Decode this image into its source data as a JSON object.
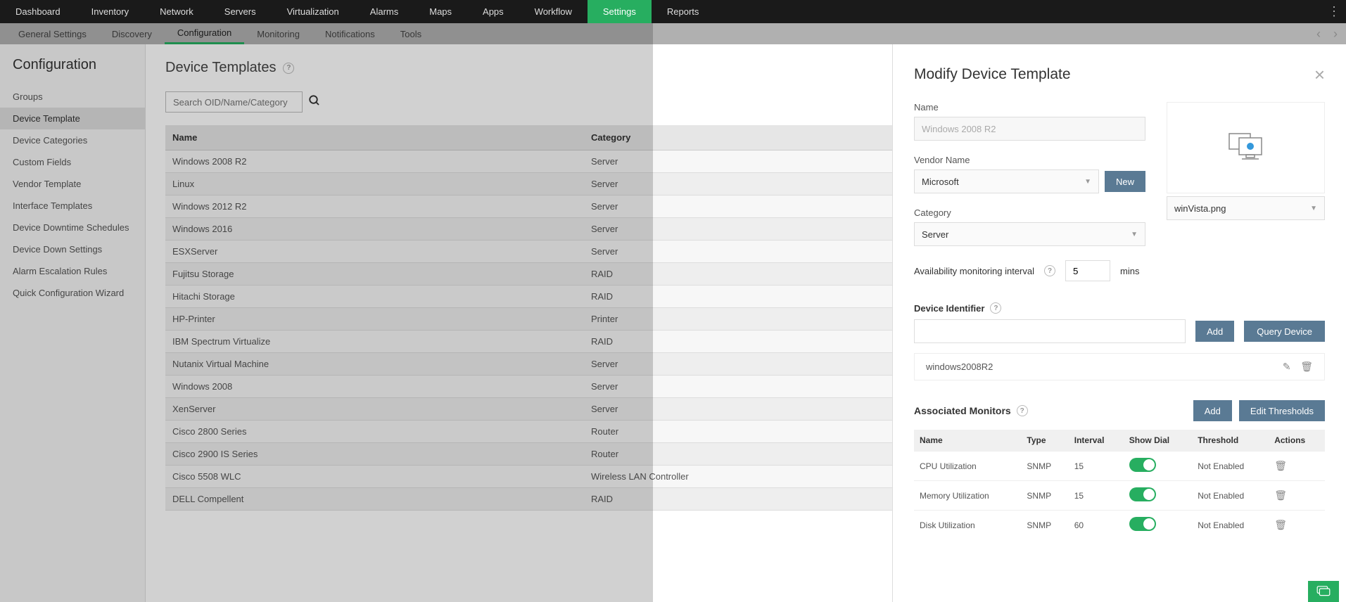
{
  "topnav": {
    "items": [
      "Dashboard",
      "Inventory",
      "Network",
      "Servers",
      "Virtualization",
      "Alarms",
      "Maps",
      "Apps",
      "Workflow",
      "Settings",
      "Reports"
    ],
    "active_index": 9
  },
  "subnav": {
    "items": [
      "General Settings",
      "Discovery",
      "Configuration",
      "Monitoring",
      "Notifications",
      "Tools"
    ],
    "active_index": 2
  },
  "sidebar": {
    "title": "Configuration",
    "items": [
      "Groups",
      "Device Template",
      "Device Categories",
      "Custom Fields",
      "Vendor Template",
      "Interface Templates",
      "Device Downtime Schedules",
      "Device Down Settings",
      "Alarm Escalation Rules",
      "Quick Configuration Wizard"
    ],
    "active_index": 1
  },
  "content": {
    "title": "Device Templates",
    "search_placeholder": "Search OID/Name/Category",
    "columns": [
      "Name",
      "Category"
    ],
    "rows": [
      {
        "name": "Windows 2008 R2",
        "category": "Server"
      },
      {
        "name": "Linux",
        "category": "Server"
      },
      {
        "name": "Windows 2012 R2",
        "category": "Server"
      },
      {
        "name": "Windows 2016",
        "category": "Server"
      },
      {
        "name": "ESXServer",
        "category": "Server"
      },
      {
        "name": "Fujitsu Storage",
        "category": "RAID"
      },
      {
        "name": "Hitachi Storage",
        "category": "RAID"
      },
      {
        "name": "HP-Printer",
        "category": "Printer"
      },
      {
        "name": "IBM Spectrum Virtualize",
        "category": "RAID"
      },
      {
        "name": "Nutanix Virtual Machine",
        "category": "Server"
      },
      {
        "name": "Windows 2008",
        "category": "Server"
      },
      {
        "name": "XenServer",
        "category": "Server"
      },
      {
        "name": "Cisco 2800 Series",
        "category": "Router"
      },
      {
        "name": "Cisco 2900 IS Series",
        "category": "Router"
      },
      {
        "name": "Cisco 5508 WLC",
        "category": "Wireless LAN Controller"
      },
      {
        "name": "DELL Compellent",
        "category": "RAID"
      }
    ]
  },
  "panel": {
    "title": "Modify Device Template",
    "name_label": "Name",
    "name_value": "Windows 2008 R2",
    "vendor_label": "Vendor Name",
    "vendor_value": "Microsoft",
    "new_btn": "New",
    "category_label": "Category",
    "category_value": "Server",
    "avail_label": "Availability monitoring interval",
    "avail_value": "5",
    "avail_unit": "mins",
    "image_file": "winVista.png",
    "device_ident_label": "Device Identifier",
    "add_btn": "Add",
    "query_btn": "Query Device",
    "identifier_value": "windows2008R2",
    "assoc_label": "Associated Monitors",
    "edit_thresh_btn": "Edit Thresholds",
    "mon_columns": [
      "Name",
      "Type",
      "Interval",
      "Show Dial",
      "Threshold",
      "Actions"
    ],
    "monitors": [
      {
        "name": "CPU Utilization",
        "type": "SNMP",
        "interval": "15",
        "threshold": "Not Enabled"
      },
      {
        "name": "Memory Utilization",
        "type": "SNMP",
        "interval": "15",
        "threshold": "Not Enabled"
      },
      {
        "name": "Disk Utilization",
        "type": "SNMP",
        "interval": "60",
        "threshold": "Not Enabled"
      }
    ]
  }
}
